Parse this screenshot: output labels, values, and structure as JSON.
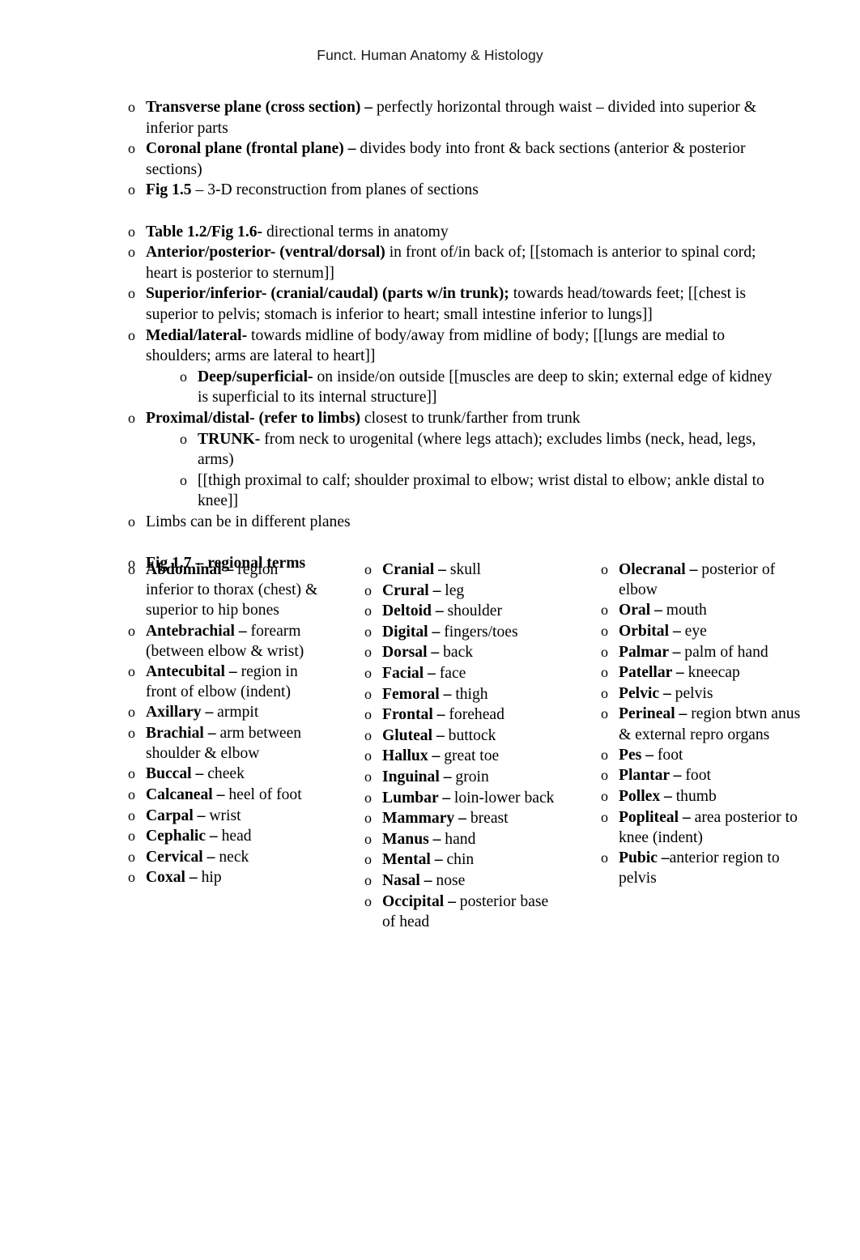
{
  "header": {
    "title": "Funct. Human Anatomy & Histology"
  },
  "bullet_marker": "o",
  "body": {
    "group1": [
      {
        "level": 1,
        "bold": "Transverse plane (cross section) –",
        "rest": " perfectly horizontal through waist – divided into superior & inferior parts"
      },
      {
        "level": 1,
        "bold": "Coronal plane (frontal plane) –",
        "rest": " divides body into front & back sections (anterior & posterior sections)"
      },
      {
        "level": 1,
        "bold": "Fig 1.5",
        "rest": " – 3-D reconstruction from planes of sections"
      }
    ],
    "group2": [
      {
        "level": 1,
        "bold": "Table 1.2/Fig 1.6-",
        "rest": " directional terms in anatomy"
      },
      {
        "level": 1,
        "bold": "Anterior/posterior- (ventral/dorsal)",
        "rest": " in front of/in back of; [[stomach is anterior to spinal cord; heart is posterior to sternum]]"
      },
      {
        "level": 1,
        "bold": "Superior/inferior- (cranial/caudal) (parts w/in trunk);",
        "rest": " towards head/towards feet; [[chest is superior to pelvis; stomach is inferior to heart; small intestine inferior to lungs]]"
      },
      {
        "level": 1,
        "bold": "Medial/lateral-",
        "rest": " towards midline of body/away from midline of body; [[lungs are medial to shoulders; arms are lateral to heart]]"
      },
      {
        "level": 2,
        "bold": "Deep/superficial-",
        "rest": " on inside/on outside [[muscles are deep to skin; external edge of kidney is superficial to its internal structure]]"
      },
      {
        "level": 1,
        "bold": "Proximal/distal- (refer to limbs)",
        "rest": " closest to trunk/farther from trunk"
      },
      {
        "level": 2,
        "bold": "TRUNK-",
        "rest": " from neck to urogenital (where legs attach); excludes limbs (neck, head, legs, arms)"
      },
      {
        "level": 2,
        "bold": "",
        "rest": "[[thigh proximal to calf; shoulder proximal to elbow; wrist distal to elbow; ankle distal to knee]]"
      },
      {
        "level": 1,
        "bold": "",
        "rest": "Limbs can be in different planes"
      }
    ],
    "group3_heading": {
      "level": 1,
      "bold": "Fig 1.7 – regional terms",
      "rest": ""
    }
  },
  "regional_terms": {
    "left": [
      {
        "term": "Abdominal –",
        "def": " region inferior to thorax (chest) & superior to hip bones"
      },
      {
        "term": "Antebrachial –",
        "def": " forearm (between elbow & wrist)"
      },
      {
        "term": "Antecubital –",
        "def": " region in front of elbow (indent)"
      },
      {
        "term": "Axillary –",
        "def": " armpit"
      },
      {
        "term": "Brachial –",
        "def": " arm between shoulder & elbow"
      },
      {
        "term": "Buccal –",
        "def": " cheek"
      },
      {
        "term": "Calcaneal –",
        "def": " heel of foot"
      },
      {
        "term": "Carpal –",
        "def": " wrist"
      },
      {
        "term": "Cephalic –",
        "def": " head"
      },
      {
        "term": "Cervical –",
        "def": " neck"
      },
      {
        "term": "Coxal –",
        "def": " hip"
      }
    ],
    "middle": [
      {
        "term": "Cranial –",
        "def": " skull"
      },
      {
        "term": "Crural –",
        "def": " leg"
      },
      {
        "term": "Deltoid –",
        "def": " shoulder"
      },
      {
        "term": "Digital –",
        "def": " fingers/toes"
      },
      {
        "term": "Dorsal –",
        "def": " back"
      },
      {
        "term": "Facial –",
        "def": " face"
      },
      {
        "term": "Femoral –",
        "def": " thigh"
      },
      {
        "term": "Frontal –",
        "def": " forehead"
      },
      {
        "term": "Gluteal –",
        "def": " buttock"
      },
      {
        "term": "Hallux –",
        "def": " great toe"
      },
      {
        "term": "Inguinal –",
        "def": " groin"
      },
      {
        "term": "Lumbar –",
        "def": " loin-lower back"
      },
      {
        "term": "Mammary –",
        "def": " breast"
      },
      {
        "term": "Manus –",
        "def": " hand"
      },
      {
        "term": "Mental –",
        "def": " chin"
      },
      {
        "term": "Nasal –",
        "def": " nose"
      },
      {
        "term": "Occipital –",
        "def": " posterior base of head"
      }
    ],
    "right": [
      {
        "term": "Olecranal –",
        "def": " posterior of elbow"
      },
      {
        "term": "Oral –",
        "def": " mouth"
      },
      {
        "term": "Orbital –",
        "def": " eye"
      },
      {
        "term": "Palmar –",
        "def": " palm of hand"
      },
      {
        "term": "Patellar –",
        "def": " kneecap"
      },
      {
        "term": "Pelvic –",
        "def": " pelvis"
      },
      {
        "term": "Perineal –",
        "def": " region btwn anus & external repro organs"
      },
      {
        "term": "Pes –",
        "def": " foot"
      },
      {
        "term": "Plantar –",
        "def": " foot"
      },
      {
        "term": "Pollex –",
        "def": " thumb"
      },
      {
        "term": "Popliteal –",
        "def": " area posterior to knee (indent)"
      },
      {
        "term": "Pubic –",
        "def": "anterior region to pelvis"
      }
    ]
  }
}
